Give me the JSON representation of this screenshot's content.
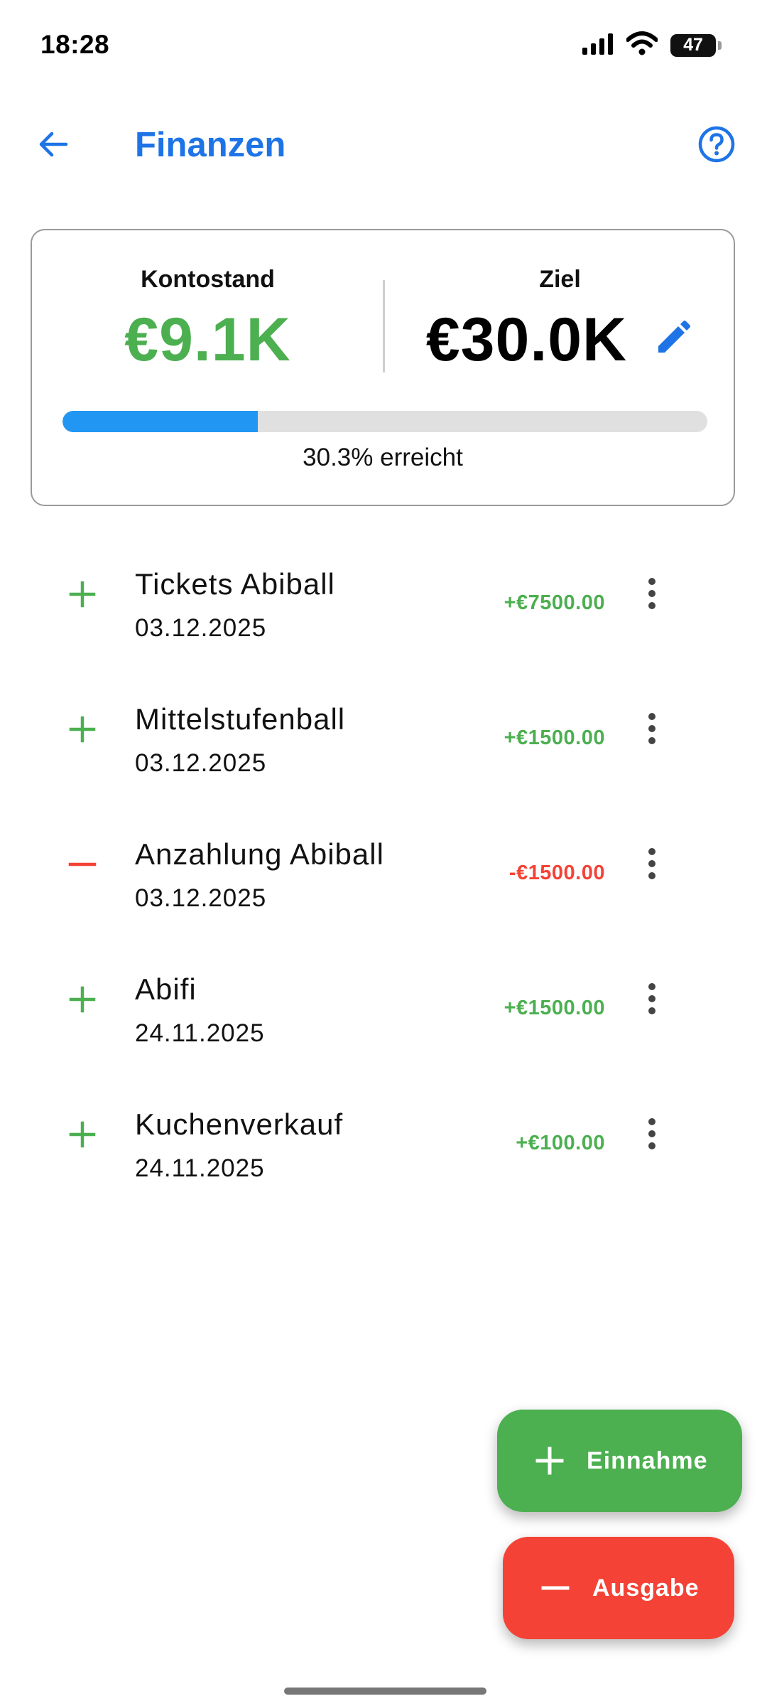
{
  "status_bar": {
    "time": "18:28",
    "battery": "47"
  },
  "app_bar": {
    "title": "Finanzen"
  },
  "summary": {
    "balance_label": "Kontostand",
    "balance_value": "€9.1K",
    "goal_label": "Ziel",
    "goal_value": "€30.0K",
    "progress_fraction": 0.303,
    "progress_text": "30.3% erreicht"
  },
  "transactions": [
    {
      "title": "Tickets Abiball",
      "date": "03.12.2025",
      "amount": "+€7500.00",
      "type": "income"
    },
    {
      "title": "Mittelstufenball",
      "date": "03.12.2025",
      "amount": "+€1500.00",
      "type": "income"
    },
    {
      "title": "Anzahlung Abiball",
      "date": "03.12.2025",
      "amount": "-€1500.00",
      "type": "expense"
    },
    {
      "title": "Abifi",
      "date": "24.11.2025",
      "amount": "+€1500.00",
      "type": "income"
    },
    {
      "title": "Kuchenverkauf",
      "date": "24.11.2025",
      "amount": "+€100.00",
      "type": "income"
    }
  ],
  "actions": {
    "income_label": "Einnahme",
    "expense_label": "Ausgabe"
  },
  "colors": {
    "accent": "#1E74E6",
    "income": "#4CAF50",
    "expense": "#F44336",
    "progress": "#2196F3"
  },
  "icons": {
    "back": "arrow-left-icon",
    "help": "help-circle-icon",
    "edit": "pencil-icon",
    "income": "plus-icon",
    "expense": "minus-icon",
    "menu": "more-vertical-icon"
  }
}
